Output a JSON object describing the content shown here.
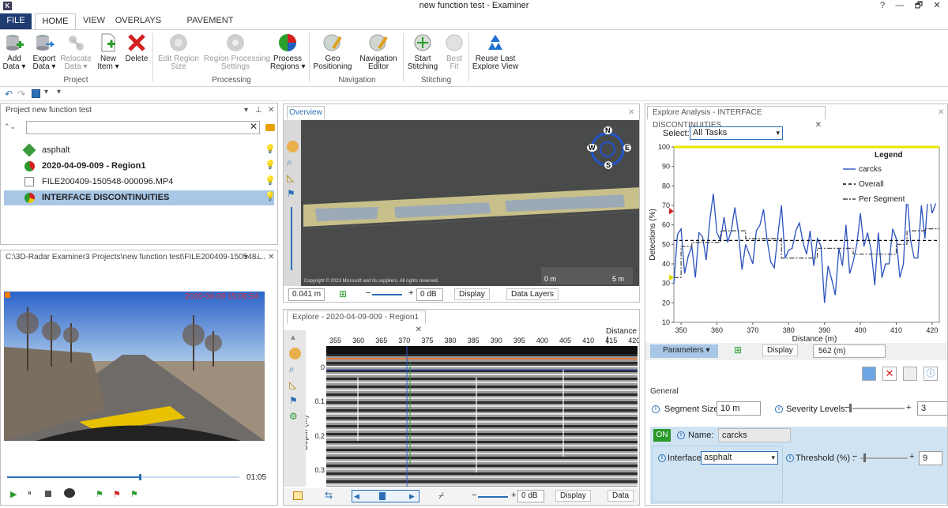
{
  "app": {
    "title": "new function test - Examiner",
    "logo_text": "K"
  },
  "window_controls": {
    "help": "?",
    "minimize": "—",
    "maximize": "🗗",
    "close": "✕"
  },
  "ribbon_tabs": [
    "FILE",
    "HOME",
    "VIEW",
    "OVERLAYS",
    "PAVEMENT ANALYSIS"
  ],
  "ribbon": {
    "project": {
      "group_label": "Project",
      "add_data": "Add\nData ▾",
      "export_data": "Export\nData ▾",
      "relocate_data": "Relocate\nData ▾",
      "new_item": "New\nItem ▾",
      "delete": "Delete"
    },
    "processing": {
      "group_label": "Processing",
      "edit_region_size": "Edit Region\nSize",
      "region_processing": "Region Processing\nSettings",
      "process_regions": "Process\nRegions ▾"
    },
    "navigation": {
      "group_label": "Navigation",
      "geo_positioning": "Geo\nPositioning",
      "navigation_editor": "Navigation\nEditor"
    },
    "stitching": {
      "group_label": "Stitching",
      "start_stitching": "Start\nStitching",
      "best_fit": "Best\nFit"
    },
    "reuse": {
      "label": "Reuse Last\nExplore View"
    }
  },
  "project_panel": {
    "title": "Project new function test",
    "items": [
      {
        "label": "asphalt",
        "bold": false,
        "selected": false
      },
      {
        "label": "2020-04-09-009 - Region1",
        "bold": true,
        "selected": false
      },
      {
        "label": "FILE200409-150548-000096.MP4",
        "bold": false,
        "selected": false
      },
      {
        "label": "INTERFACE DISCONTINUITIES",
        "bold": true,
        "selected": true
      }
    ]
  },
  "video_panel": {
    "title": "C:\\3D-Radar Examiner3 Projects\\new function test\\FILE200409-150548-...",
    "timestamp": "2020-04-09 15:06:54",
    "duration": "01:05",
    "progress": 0.57
  },
  "overview_panel": {
    "tab": "Overview",
    "copyright": "Copyright © 2023 Microsoft and its suppliers. All rights reserved.",
    "scale_left": "0 m",
    "scale_right": "5 m",
    "compass": {
      "n": "N",
      "s": "S",
      "e": "E",
      "w": "W"
    },
    "distance_value": "0.041 m",
    "gain_value": "0 dB",
    "display_button": "Display",
    "data_layers_button": "Data Layers"
  },
  "explore_panel": {
    "tab": "Explore - 2020-04-09-009 - Region1",
    "x_axis_title": "Distance (",
    "x_ticks": [
      "355",
      "360",
      "365",
      "370",
      "375",
      "380",
      "385",
      "390",
      "395",
      "400",
      "405",
      "410",
      "415",
      "420"
    ],
    "y_axis_title": "Depth (m)",
    "y_ticks": [
      "0",
      "0.1",
      "0.2",
      "0.3"
    ],
    "gain_value": "0 dB",
    "display_button": "Display",
    "data_button": "Data"
  },
  "analysis_panel": {
    "tab": "Explore Analysis - INTERFACE DISCONTINUITIES",
    "select_label": "Select:",
    "select_value": "All Tasks",
    "parameters_button": "Parameters",
    "display_button": "Display",
    "distance_value": "562 (m)",
    "general_label": "General",
    "segment_size_label": "Segment Size:",
    "segment_size_value": "10 m",
    "severity_label": "Severity Levels:",
    "severity_value": "3",
    "on_label": "ON",
    "name_label": "Name:",
    "name_value": "carcks",
    "interface_label": "Interface :",
    "interface_value": "asphalt",
    "threshold_label": "Threshold (%) :",
    "threshold_value": "9",
    "minus": "−",
    "plus": "+"
  },
  "chart_data": {
    "type": "line",
    "title": "",
    "xlabel": "Distance (m)",
    "ylabel": "Detections (%)",
    "xlim": [
      348,
      422
    ],
    "ylim": [
      10,
      100
    ],
    "x_ticks": [
      350,
      360,
      370,
      380,
      390,
      400,
      410,
      420
    ],
    "y_ticks": [
      10,
      20,
      30,
      40,
      50,
      60,
      70,
      80,
      90,
      100
    ],
    "legend_title": "Legend",
    "legend_position": "top-right",
    "series": [
      {
        "name": "carcks",
        "style": "solid",
        "color": "#2a52be",
        "x": [
          348,
          349,
          350,
          351,
          352,
          353,
          354,
          355,
          356,
          357,
          358,
          359,
          360,
          361,
          362,
          363,
          364,
          365,
          366,
          367,
          368,
          369,
          370,
          371,
          372,
          373,
          374,
          375,
          376,
          377,
          378,
          379,
          380,
          381,
          382,
          383,
          384,
          385,
          386,
          387,
          388,
          389,
          390,
          391,
          392,
          393,
          394,
          395,
          396,
          397,
          398,
          399,
          400,
          401,
          402,
          403,
          404,
          405,
          406,
          407,
          408,
          409,
          410,
          411,
          412,
          413,
          414,
          415,
          416,
          417,
          418,
          419,
          420,
          421
        ],
        "y": [
          30,
          55,
          58,
          35,
          44,
          49,
          33,
          56,
          54,
          42,
          62,
          76,
          56,
          52,
          64,
          51,
          57,
          69,
          56,
          37,
          50,
          45,
          40,
          57,
          60,
          68,
          52,
          41,
          38,
          55,
          70,
          43,
          47,
          48,
          57,
          61,
          51,
          45,
          57,
          39,
          53,
          49,
          20,
          39,
          32,
          24,
          48,
          39,
          60,
          35,
          41,
          50,
          66,
          49,
          56,
          47,
          29,
          56,
          33,
          40,
          40,
          58,
          53,
          33,
          40,
          76,
          52,
          43,
          43,
          70,
          53,
          79,
          66,
          71
        ]
      },
      {
        "name": "Overall",
        "style": "dashed",
        "color": "#000000",
        "x": [
          348,
          422
        ],
        "y": [
          52,
          52
        ]
      },
      {
        "name": "Per Segment",
        "style": "dashdot",
        "color": "#444444",
        "x": [
          348,
          350,
          350,
          353,
          353,
          361,
          361,
          368,
          368,
          378,
          378,
          388,
          388,
          398,
          398,
          406,
          406,
          410,
          410,
          413,
          413,
          418,
          418,
          422
        ],
        "y": [
          33,
          33,
          49,
          49,
          51,
          51,
          57,
          57,
          53,
          53,
          43,
          43,
          48,
          48,
          45,
          45,
          45,
          45,
          50,
          50,
          57,
          57,
          58,
          58
        ]
      }
    ],
    "thresholds": [
      {
        "value": 100,
        "color": "#e6e600"
      }
    ],
    "markers": [
      {
        "value": 67,
        "color": "#cc2222"
      },
      {
        "value": 33,
        "color": "#d8d800"
      }
    ]
  }
}
